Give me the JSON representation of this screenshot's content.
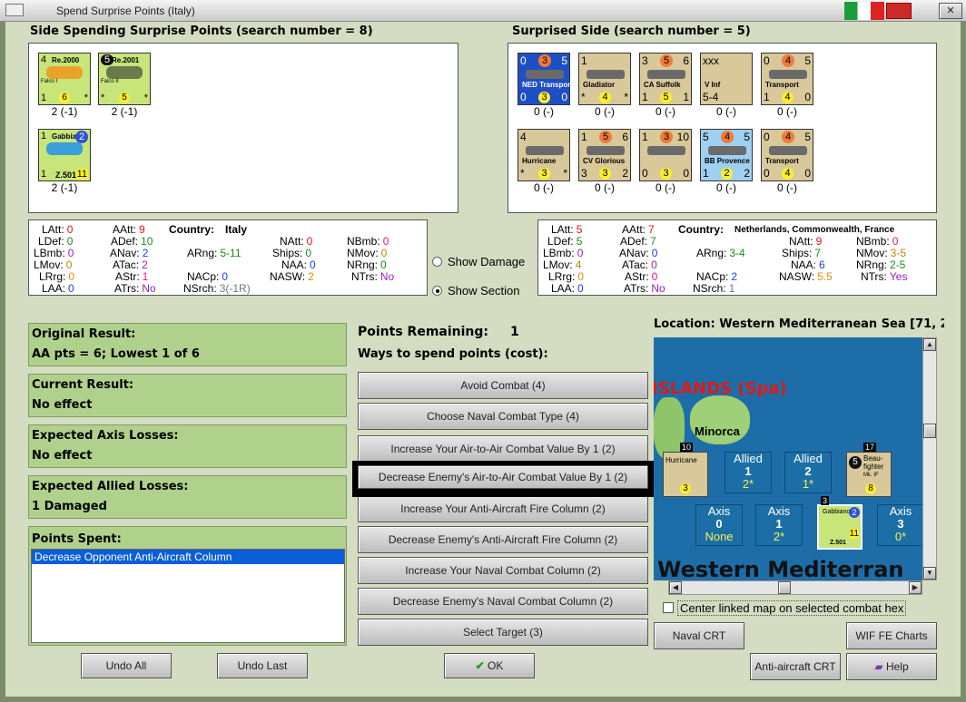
{
  "window": {
    "title": "Spend Surprise Points (Italy)"
  },
  "left_side": {
    "header": "Side Spending Surprise Points (search number = 8)",
    "units": [
      {
        "top": "4",
        "name": "Re.2000",
        "sub": "Falco I",
        "bl": "1",
        "bm": "6",
        "br": "*",
        "caption": "2 (-1)"
      },
      {
        "top": "5",
        "name": "Re.2001",
        "sub": "Falco II",
        "bl": "*",
        "bm": "5",
        "br": "*",
        "caption": "2 (-1)"
      },
      {
        "top": "1",
        "name": "Gabbiano",
        "sub": "Z.501",
        "bl": "1",
        "bm": "11",
        "br": "2",
        "caption": "2 (-1)"
      }
    ]
  },
  "right_side": {
    "header": "Surprised Side (search number = 5)",
    "units": [
      {
        "t1": "0",
        "t2": "3",
        "t3": "5",
        "name": "NED Transport",
        "b1": "0",
        "b2": "3",
        "b3": "0",
        "caption": "0 (-)"
      },
      {
        "t1": "1",
        "name": "Gladiator",
        "b1": "*",
        "b2": "4",
        "b3": "*",
        "caption": "0 (-)"
      },
      {
        "t1": "3",
        "t2": "5",
        "t3": "6",
        "name": "CA Suffolk",
        "b1": "1",
        "b2": "5",
        "b3": "1",
        "caption": "0 (-)"
      },
      {
        "t1": "xxx",
        "name": "V Inf",
        "b1": "5-4",
        "caption": "0 (-)"
      },
      {
        "t1": "0",
        "t2": "4",
        "t3": "5",
        "name": "Transport",
        "b1": "1",
        "b2": "4",
        "b3": "0",
        "caption": "0 (-)"
      },
      {
        "t1": "4",
        "name": "Hurricane",
        "b1": "*",
        "b2": "3",
        "b3": "*",
        "caption": "0 (-)"
      },
      {
        "t1": "1",
        "t2": "5",
        "t3": "6",
        "name": "CV Glorious",
        "b1": "3",
        "b2": "3",
        "b3": "2",
        "caption": "0 (-)"
      },
      {
        "t1": "1",
        "t2": "3",
        "t3": "10",
        "name": "",
        "b1": "0",
        "b2": "3",
        "b3": "0",
        "caption": "0 (-)"
      },
      {
        "t1": "5",
        "t2": "4",
        "t3": "5",
        "name": "BB Provence",
        "b1": "1",
        "b2": "2",
        "b3": "2",
        "caption": "0 (-)"
      },
      {
        "t1": "0",
        "t2": "4",
        "t3": "5",
        "name": "Transport",
        "b1": "0",
        "b2": "4",
        "b3": "0",
        "caption": "0 (-)"
      }
    ]
  },
  "left_stats": {
    "country_label": "Country:",
    "country": "Italy",
    "LAtt": "0",
    "LDef": "0",
    "LBmb": "0",
    "LMov": "0",
    "LRrg": "0",
    "LAA": "0",
    "AAtt": "9",
    "ADef": "10",
    "ANav": "2",
    "ATac": "2",
    "AStr": "1",
    "ATrs": "No",
    "ARng": "5-11",
    "NACp": "0",
    "NSrch": "3(-1R)",
    "NAtt": "0",
    "Ships": "0",
    "NAA": "0",
    "NASW": "2",
    "NBmb": "0",
    "NMov": "0",
    "NRng": "0",
    "NTrs": "No"
  },
  "right_stats": {
    "country_label": "Country:",
    "country": "Netherlands, Commonwealth, France",
    "LAtt": "5",
    "LDef": "5",
    "LBmb": "0",
    "LMov": "4",
    "LRrg": "0",
    "LAA": "0",
    "AAtt": "7",
    "ADef": "7",
    "ANav": "0",
    "ATac": "0",
    "AStr": "0",
    "ATrs": "No",
    "ARng": "3-4",
    "NACp": "2",
    "NSrch": "1",
    "NAtt": "9",
    "Ships": "7",
    "NAA": "6",
    "NASW": "5.5",
    "NBmb": "0",
    "NMov": "3-5",
    "NRng": "2-5",
    "NTrs": "Yes"
  },
  "labels": {
    "LAtt": "LAtt:",
    "LDef": "LDef:",
    "LBmb": "LBmb:",
    "LMov": "LMov:",
    "LRrg": "LRrg:",
    "LAA": "LAA:",
    "AAtt": "AAtt:",
    "ADef": "ADef:",
    "ANav": "ANav:",
    "ATac": "ATac:",
    "AStr": "AStr:",
    "ATrs": "ATrs:",
    "ARng": "ARng:",
    "NACp": "NACp:",
    "NSrch": "NSrch:",
    "NAtt": "NAtt:",
    "Ships": "Ships:",
    "NAA": "NAA:",
    "NASW": "NASW:",
    "NBmb": "NBmb:",
    "NMov": "NMov:",
    "NRng": "NRng:",
    "NTrs": "NTrs:"
  },
  "radios": {
    "show_damage": "Show Damage",
    "show_section": "Show Section",
    "selected": "show_section"
  },
  "results": {
    "original_label": "Original Result:",
    "original_value": "AA pts = 6; Lowest 1 of 6",
    "current_label": "Current Result:",
    "current_value": "No effect",
    "axis_label": "Expected Axis Losses:",
    "axis_value": "No effect",
    "allied_label": "Expected Allied Losses:",
    "allied_value": "1 Damaged",
    "spent_label": "Points Spent:",
    "spent_items": [
      "Decrease Opponent Anti-Aircraft Column"
    ]
  },
  "points": {
    "label": "Points Remaining:",
    "value": "1",
    "ways_label": "Ways to spend points (cost):"
  },
  "options": [
    "Avoid Combat (4)",
    "Choose Naval Combat Type (4)",
    "Increase Your Air-to-Air Combat Value By 1 (2)",
    "Decrease Enemy's Air-to-Air Combat Value By 1 (2)",
    "Increase Your Anti-Aircraft Fire Column (2)",
    "Decrease Enemy's Anti-Aircraft Fire Column (2)",
    "Increase Your Naval Combat Column (2)",
    "Decrease Enemy's Naval Combat Column (2)",
    "Select Target (3)"
  ],
  "map": {
    "location": "Location: Western Mediterranean Sea [71, 2",
    "islands": "ISLANDS (Spa)",
    "minorca": "Minorca",
    "sea_label": "Western Mediterran",
    "stacks": [
      {
        "side": "Allied",
        "value": "1",
        "sub": "2*"
      },
      {
        "side": "Allied",
        "value": "2",
        "sub": "1*"
      },
      {
        "side": "Axis",
        "value": "0",
        "sub": "None"
      },
      {
        "side": "Axis",
        "value": "1",
        "sub": "2*"
      },
      {
        "side": "Axis",
        "value": "3",
        "sub": "0*"
      }
    ],
    "counter_hurricane": {
      "tag": "10",
      "name": "Hurricane",
      "value": "3"
    },
    "counter_beau": {
      "tag": "17",
      "name": "Beau-fighter",
      "sub": "Mk. IF",
      "top": "5",
      "value": "8"
    },
    "counter_gabbiano": {
      "tag": "3",
      "name": "Gabbiano",
      "sub": "Z.501",
      "value": "11",
      "right": "2"
    },
    "center_linked": "Center linked map on selected combat hex"
  },
  "buttons": {
    "undo_all": "Undo All",
    "undo_last": "Undo Last",
    "ok": "OK",
    "naval_crt": "Naval CRT",
    "wif_fe": "WIF FE Charts",
    "aa_crt": "Anti-aircraft CRT",
    "help": "Help"
  },
  "colors": {
    "panel_green": "#b0d18c",
    "background": "#d4dcc1",
    "sea": "#1d6ea8",
    "yellow_circle": "#ffef2a"
  }
}
